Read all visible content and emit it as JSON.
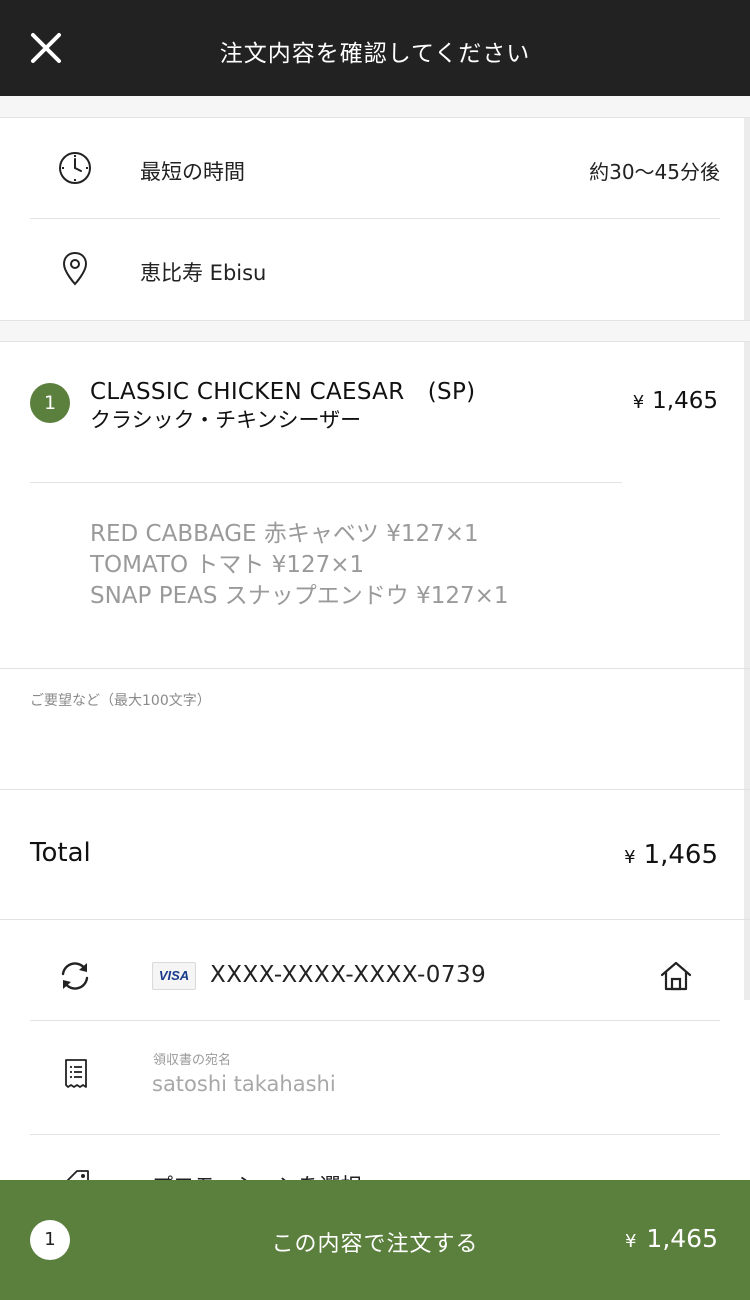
{
  "header": {
    "title": "注文内容を確認してください"
  },
  "delivery": {
    "time_label": "最短の時間",
    "time_value": "約30〜45分後",
    "location": "恵比寿 Ebisu"
  },
  "item": {
    "quantity": "1",
    "name_en": "CLASSIC CHICKEN CAESAR　(SP)",
    "name_ja": "クラシック・チキンシーザー",
    "currency": "¥",
    "price": "1,465",
    "options": [
      "RED CABBAGE 赤キャベツ ¥127×1",
      "TOMATO トマト ¥127×1",
      "SNAP PEAS スナップエンドウ ¥127×1"
    ]
  },
  "notes": {
    "placeholder": "ご要望など（最大100文字）"
  },
  "total": {
    "label": "Total",
    "currency": "¥",
    "amount": "1,465"
  },
  "payment": {
    "card_brand": "VISA",
    "card_number": "XXXX-XXXX-XXXX-0739"
  },
  "receipt": {
    "label": "領収書の宛名",
    "name": "satoshi takahashi"
  },
  "promotion": {
    "label": "プロモーションを選択"
  },
  "footer": {
    "count": "1",
    "label": "この内容で注文する",
    "currency": "¥",
    "amount": "1,465"
  },
  "colors": {
    "header_bg": "#222222",
    "accent_green": "#5b7f3c",
    "muted_text": "#9a9a9a"
  },
  "icons": [
    "close-icon",
    "clock-icon",
    "location-pin-icon",
    "refresh-icon",
    "home-icon",
    "receipt-icon",
    "tag-icon"
  ]
}
